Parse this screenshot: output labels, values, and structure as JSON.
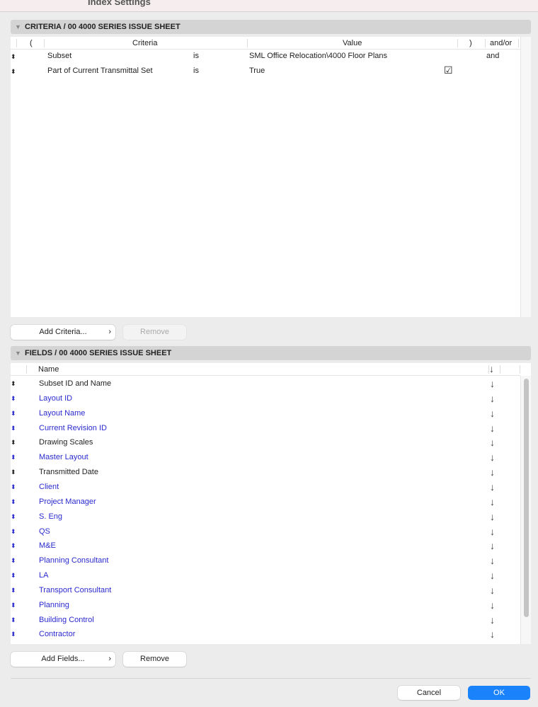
{
  "window": {
    "title": "Index Settings"
  },
  "criteria": {
    "header": "CRITERIA / 00 4000 SERIES ISSUE SHEET",
    "columns": [
      "(",
      "Criteria",
      "Value",
      ")",
      "and/or"
    ],
    "rows": [
      {
        "criteria": "Subset",
        "operator": "is",
        "value": "SML Office Relocation\\4000 Floor Plans",
        "checked": false,
        "andor": "and"
      },
      {
        "criteria": "Part of Current Transmittal Set",
        "operator": "is",
        "value": "True",
        "checked": true,
        "andor": ""
      }
    ],
    "add_label": "Add Criteria...",
    "remove_label": "Remove"
  },
  "fields": {
    "header": "FIELDS / 00 4000 SERIES ISSUE SHEET",
    "column_name": "Name",
    "rows": [
      {
        "name": "Subset ID and Name",
        "custom": false
      },
      {
        "name": "Layout ID",
        "custom": true
      },
      {
        "name": "Layout Name",
        "custom": true
      },
      {
        "name": "Current Revision ID",
        "custom": true
      },
      {
        "name": "Drawing Scales",
        "custom": false
      },
      {
        "name": "Master Layout",
        "custom": true
      },
      {
        "name": "Transmitted Date",
        "custom": false
      },
      {
        "name": "Client",
        "custom": true
      },
      {
        "name": "Project Manager",
        "custom": true
      },
      {
        "name": "S. Eng",
        "custom": true
      },
      {
        "name": "QS",
        "custom": true
      },
      {
        "name": "M&E",
        "custom": true
      },
      {
        "name": "Planning Consultant",
        "custom": true
      },
      {
        "name": "LA",
        "custom": true
      },
      {
        "name": "Transport Consultant",
        "custom": true
      },
      {
        "name": "Planning",
        "custom": true
      },
      {
        "name": "Building Control",
        "custom": true
      },
      {
        "name": "Contractor",
        "custom": true
      }
    ],
    "sort_icon": "down-arrow-icon",
    "add_label": "Add Fields...",
    "remove_label": "Remove"
  },
  "footer": {
    "cancel_label": "Cancel",
    "ok_label": "OK"
  },
  "colors": {
    "accent": "#1a82fb",
    "custom_field": "#2a2ad0"
  }
}
